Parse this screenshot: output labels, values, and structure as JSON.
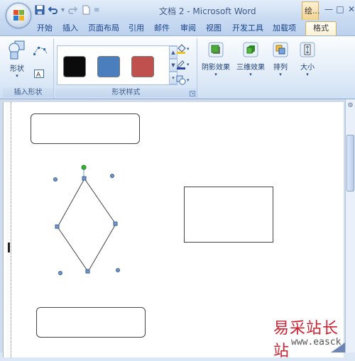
{
  "window": {
    "title": "文档 2 - Microsoft Word",
    "context_tab_group": "绘...",
    "controls": [
      "—",
      "□",
      "✕"
    ]
  },
  "tabs": [
    {
      "label": "开始"
    },
    {
      "label": "插入"
    },
    {
      "label": "页面布局"
    },
    {
      "label": "引用"
    },
    {
      "label": "邮件"
    },
    {
      "label": "审阅"
    },
    {
      "label": "视图"
    },
    {
      "label": "开发工具"
    },
    {
      "label": "加载项"
    },
    {
      "label": "格式",
      "active": true
    }
  ],
  "ribbon": {
    "insert_shapes": {
      "group_label": "插入形状",
      "shapes_button": "形状"
    },
    "shape_styles": {
      "group_label": "形状样式",
      "swatches": [
        {
          "name": "black-style",
          "color": "#0b0b0b"
        },
        {
          "name": "blue-style",
          "color": "#4a7ebd"
        },
        {
          "name": "red-style",
          "color": "#c0504d"
        }
      ]
    },
    "shadow_effects": {
      "label": "阴影效果"
    },
    "3d_effects": {
      "label": "三维效果"
    },
    "arrange": {
      "label": "排列"
    },
    "size": {
      "label": "大小"
    }
  },
  "watermark": {
    "text": "易采站长站",
    "url": "www.easck.com"
  },
  "colors": {
    "accent": "#15428b",
    "handle_blue": "#6f95c9",
    "rotation_handle": "#36b336"
  }
}
